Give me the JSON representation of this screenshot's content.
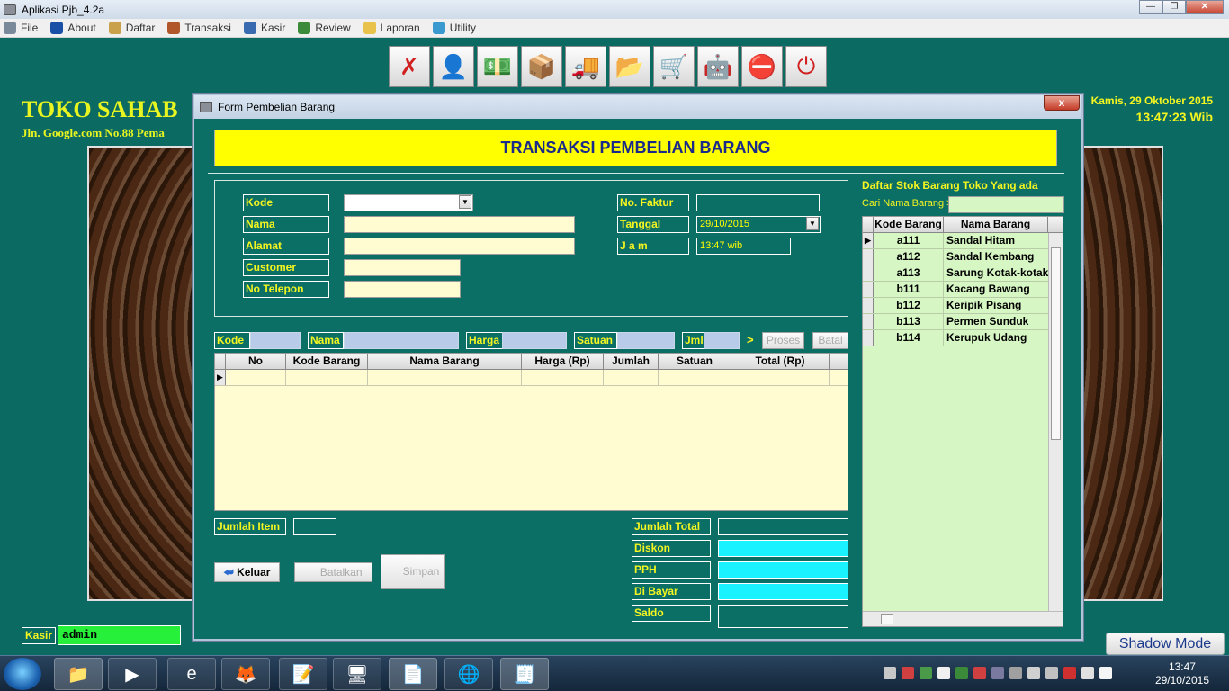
{
  "window": {
    "title": "Aplikasi Pjb_4.2a"
  },
  "menu": [
    {
      "label": "File",
      "icon": "file-icon",
      "color": "#7a8a9a"
    },
    {
      "label": "About",
      "icon": "help-icon",
      "color": "#1a4fa8"
    },
    {
      "label": "Daftar",
      "icon": "list-icon",
      "color": "#c9a14a"
    },
    {
      "label": "Transaksi",
      "icon": "transaction-icon",
      "color": "#b0562a"
    },
    {
      "label": "Kasir",
      "icon": "user-icon",
      "color": "#3a6ab0"
    },
    {
      "label": "Review",
      "icon": "review-icon",
      "color": "#3a8a3a"
    },
    {
      "label": "Laporan",
      "icon": "folder-icon",
      "color": "#e8c24a"
    },
    {
      "label": "Utility",
      "icon": "gear-icon",
      "color": "#3a9ad0"
    }
  ],
  "toolbar": [
    {
      "name": "cancel-tool",
      "glyph": "✗",
      "color": "#d02020"
    },
    {
      "name": "user-tool",
      "glyph": "👤",
      "color": "#2a5aa0"
    },
    {
      "name": "money-tool",
      "glyph": "💵",
      "color": "#4a8a4a"
    },
    {
      "name": "box-tool",
      "glyph": "📦",
      "color": "#c08a30"
    },
    {
      "name": "truck-tool",
      "glyph": "🚚",
      "color": "#2a8a3a"
    },
    {
      "name": "folder-user-tool",
      "glyph": "📂",
      "color": "#3a7ab0"
    },
    {
      "name": "cart-tool",
      "glyph": "🛒",
      "color": "#5a5a5a"
    },
    {
      "name": "robot-tool",
      "glyph": "🤖",
      "color": "#2a6aa0"
    },
    {
      "name": "stop-tool",
      "glyph": "⛔",
      "color": "#c02020"
    },
    {
      "name": "power-tool",
      "glyph": "⏻",
      "color": "#d02020"
    }
  ],
  "header": {
    "store_name": "TOKO SAHAB",
    "store_address": "Jln. Google.com No.88 Pema",
    "date": "Kamis, 29 Oktober 2015",
    "time": "13:47:23 Wib"
  },
  "form": {
    "title": "Form Pembelian Barang",
    "close": "x",
    "banner": "TRANSAKSI PEMBELIAN BARANG",
    "supplier": {
      "kode_label": "Kode",
      "kode_value": "",
      "nama_label": "Nama",
      "nama_value": "",
      "alamat_label": "Alamat",
      "alamat_value": "",
      "customer_label": "Customer",
      "customer_value": "",
      "telepon_label": "No Telepon",
      "telepon_value": ""
    },
    "faktur": {
      "faktur_label": "No. Faktur",
      "faktur_value": "",
      "tanggal_label": "Tanggal",
      "tanggal_value": "29/10/2015",
      "jam_label": "J a m",
      "jam_value": "13:47 wib"
    },
    "entry": {
      "kode_label": "Kode",
      "nama_label": "Nama",
      "harga_label": "Harga",
      "satuan_label": "Satuan",
      "jml_label": "Jml",
      "arrow": ">",
      "proses": "Proses",
      "batal": "Batal"
    },
    "grid_columns": [
      "No",
      "Kode Barang",
      "Nama Barang",
      "Harga (Rp)",
      "Jumlah",
      "Satuan",
      "Total (Rp)"
    ],
    "footer": {
      "jumlah_item_label": "Jumlah Item",
      "jumlah_item_value": "",
      "jumlah_total_label": "Jumlah Total",
      "jumlah_total_value": "",
      "diskon_label": "Diskon",
      "pph_label": "PPH",
      "bayar_label": "Di Bayar",
      "saldo_label": "Saldo",
      "keluar": "Keluar",
      "batalkan": "Batalkan",
      "simpan": "Simpan"
    },
    "stock": {
      "title": "Daftar Stok Barang Toko Yang ada",
      "search_label": "Cari Nama Barang >",
      "columns": [
        "Kode Barang",
        "Nama Barang"
      ],
      "rows": [
        {
          "kode": "a111",
          "nama": "Sandal Hitam"
        },
        {
          "kode": "a112",
          "nama": "Sandal Kembang"
        },
        {
          "kode": "a113",
          "nama": "Sarung Kotak-kotak"
        },
        {
          "kode": "b111",
          "nama": "Kacang Bawang"
        },
        {
          "kode": "b112",
          "nama": "Keripik Pisang"
        },
        {
          "kode": "b113",
          "nama": "Permen Sunduk"
        },
        {
          "kode": "b114",
          "nama": "Kerupuk Udang"
        }
      ]
    }
  },
  "status": {
    "kasir_label": "Kasir",
    "kasir_value": "admin",
    "shadow_mode": "Shadow Mode"
  },
  "taskbar": {
    "items": [
      {
        "name": "explorer-taskbar",
        "glyph": "📁"
      },
      {
        "name": "media-player-taskbar",
        "glyph": "▶"
      },
      {
        "name": "internet-explorer-taskbar",
        "glyph": "e"
      },
      {
        "name": "firefox-taskbar",
        "glyph": "🦊"
      },
      {
        "name": "notepad-taskbar",
        "glyph": "📝"
      },
      {
        "name": "vb-ide-taskbar",
        "glyph": "🖥"
      },
      {
        "name": "notes-taskbar",
        "glyph": "📄"
      },
      {
        "name": "globe-taskbar",
        "glyph": "🌐"
      },
      {
        "name": "cash-register-taskbar",
        "glyph": "🧾"
      }
    ],
    "clock_time": "13:47",
    "clock_date": "29/10/2015"
  }
}
